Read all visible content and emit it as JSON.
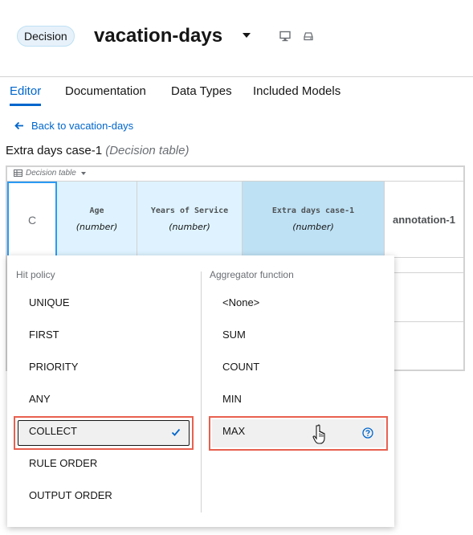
{
  "header": {
    "badge": "Decision",
    "title": "vacation-days",
    "icons": [
      "chevron-down-icon",
      "monitor-icon",
      "drive-icon"
    ]
  },
  "tabs": [
    {
      "label": "Editor",
      "active": true
    },
    {
      "label": "Documentation",
      "active": false
    },
    {
      "label": "Data Types",
      "active": false
    },
    {
      "label": "Included Models",
      "active": false
    }
  ],
  "back_link": "Back to vacation-days",
  "expression": {
    "name": "Extra days case-1",
    "type": "(Decision table)"
  },
  "table": {
    "type_label": "Decision table",
    "hit_policy_cell": "C",
    "columns": [
      {
        "name": "Age",
        "type": "(number)"
      },
      {
        "name": "Years of Service",
        "type": "(number)"
      },
      {
        "name": "Extra days case-1",
        "type": "(number)"
      },
      {
        "name": "annotation-1"
      }
    ]
  },
  "popover": {
    "hit_policy_header": "Hit policy",
    "aggregator_header": "Aggregator function",
    "hit_policies": [
      "UNIQUE",
      "FIRST",
      "PRIORITY",
      "ANY",
      "COLLECT",
      "RULE ORDER",
      "OUTPUT ORDER"
    ],
    "selected_hit_policy": "COLLECT",
    "aggregators": [
      "<None>",
      "SUM",
      "COUNT",
      "MIN",
      "MAX"
    ],
    "hovered_aggregator": "MAX"
  },
  "colors": {
    "accent": "#0066cc",
    "input_column": "#def3ff",
    "output_column": "#bee1f4",
    "highlight": "#e8604f"
  }
}
